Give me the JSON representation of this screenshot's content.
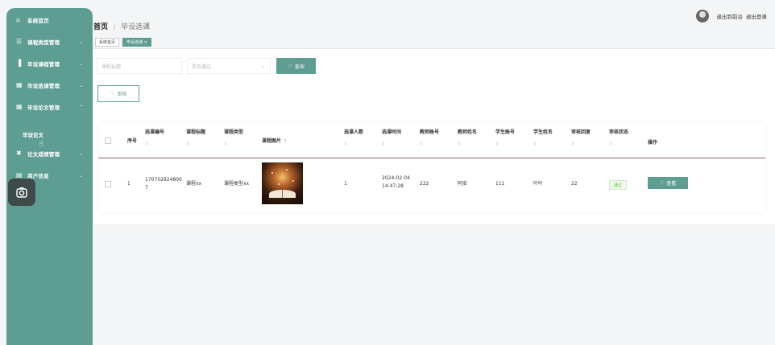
{
  "sidebar": {
    "items": [
      {
        "label": "系统首页",
        "icon": "home-icon"
      },
      {
        "label": "课程类型管理",
        "icon": "sliders-icon"
      },
      {
        "label": "毕设课程管理",
        "icon": "bar-chart-icon"
      },
      {
        "label": "毕设选课管理",
        "icon": "grid-icon"
      },
      {
        "label": "毕设论文管理",
        "icon": "grid-icon"
      },
      {
        "label": "论文成绩管理",
        "icon": "dumbbell-icon"
      },
      {
        "label": "用户信息",
        "icon": "card-icon"
      }
    ],
    "sub_item": "毕设论文"
  },
  "topbar": {
    "back_label": "退出到前台",
    "logout_label": "退出登录"
  },
  "breadcrumb": {
    "home": "首页",
    "current": "毕设选课"
  },
  "tags": {
    "home": "系统首页",
    "current": "毕设选课 ×"
  },
  "search": {
    "title_placeholder": "课程标题",
    "select_placeholder": "是否通过",
    "query_label": "查询",
    "audit_label": "审核"
  },
  "table": {
    "headers": [
      "序号",
      "选课编号",
      "课程标题",
      "课程类型",
      "课程图片",
      "选课人数",
      "选课时间",
      "教师账号",
      "教师姓名",
      "学生账号",
      "学生姓名",
      "审核回复",
      "审核状态",
      "操作"
    ],
    "row": {
      "index": "1",
      "code": "1707029248007",
      "title": "课程xx",
      "type": "课程类型xx",
      "count": "1",
      "time": "2024-02-04 14:47:28",
      "teacher_account": "222",
      "teacher_name": "阿安",
      "student_account": "111",
      "student_name": "叶叶",
      "reply": "22",
      "status": "通过",
      "view_label": "查看"
    }
  },
  "colors": {
    "accent": "#5e9e92",
    "status_green": "#67c23a"
  }
}
